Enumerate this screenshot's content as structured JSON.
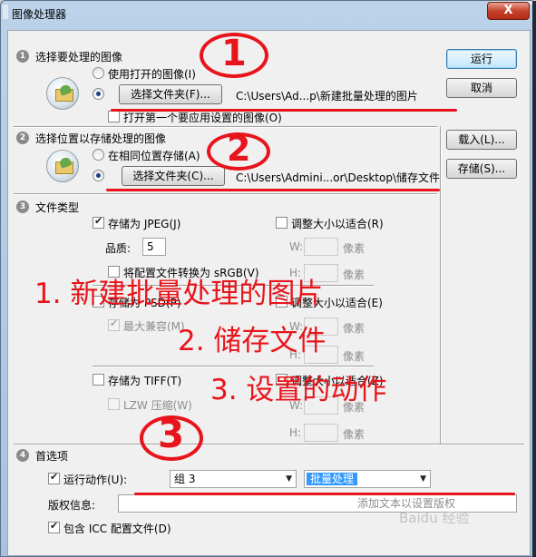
{
  "window": {
    "title": "图像处理器",
    "close": "X",
    "colors": {
      "annotation": "#e8141b",
      "selection": "#3399ff"
    }
  },
  "actions": {
    "run": "运行",
    "cancel": "取消",
    "load": "载入(L)...",
    "save": "存储(S)..."
  },
  "section1": {
    "number": "1",
    "title": "选择要处理的图像",
    "radio_open": "使用打开的图像(I)",
    "select_folder": "选择文件夹(F)...",
    "path": "C:\\Users\\Ad...p\\新建批量处理的图片",
    "open_first": "打开第一个要应用设置的图像(O)"
  },
  "section2": {
    "number": "2",
    "title": "选择位置以存储处理的图像",
    "radio_same": "在相同位置存储(A)",
    "select_folder": "选择文件夹(C)...",
    "path": "C:\\Users\\Admini...or\\Desktop\\储存文件"
  },
  "section3": {
    "number": "3",
    "title": "文件类型",
    "jpeg": "存储为 JPEG(J)",
    "resize_jpeg": "调整大小以适合(R)",
    "quality_label": "品质:",
    "quality_value": "5",
    "w_label": "W:",
    "h_label": "H:",
    "px": "像素",
    "convert_srgb": "将配置文件转换为 sRGB(V)",
    "psd": "存储为 PSD(P)",
    "resize_psd": "调整大小以适合(E)",
    "max_compat": "最大兼容(M)",
    "tiff": "存储为 TIFF(T)",
    "resize_tiff": "调整大小以适合(Z)",
    "lzw": "LZW 压缩(W)"
  },
  "section4": {
    "number": "4",
    "title": "首选项",
    "run_action": "运行动作(U):",
    "action_set": "组 3",
    "action": "批量处理",
    "copyright_label": "版权信息:",
    "copyright_hint": "添加文本以设置版权",
    "include_icc": "包含 ICC 配置文件(D)"
  },
  "annotations": {
    "circle1": "1",
    "circle2": "2",
    "circle3": "3",
    "line1": "1. 新建批量处理的图片",
    "line2": "2. 储存文件",
    "line3": "3. 设置的动作"
  },
  "watermark": "Baidu 经验"
}
